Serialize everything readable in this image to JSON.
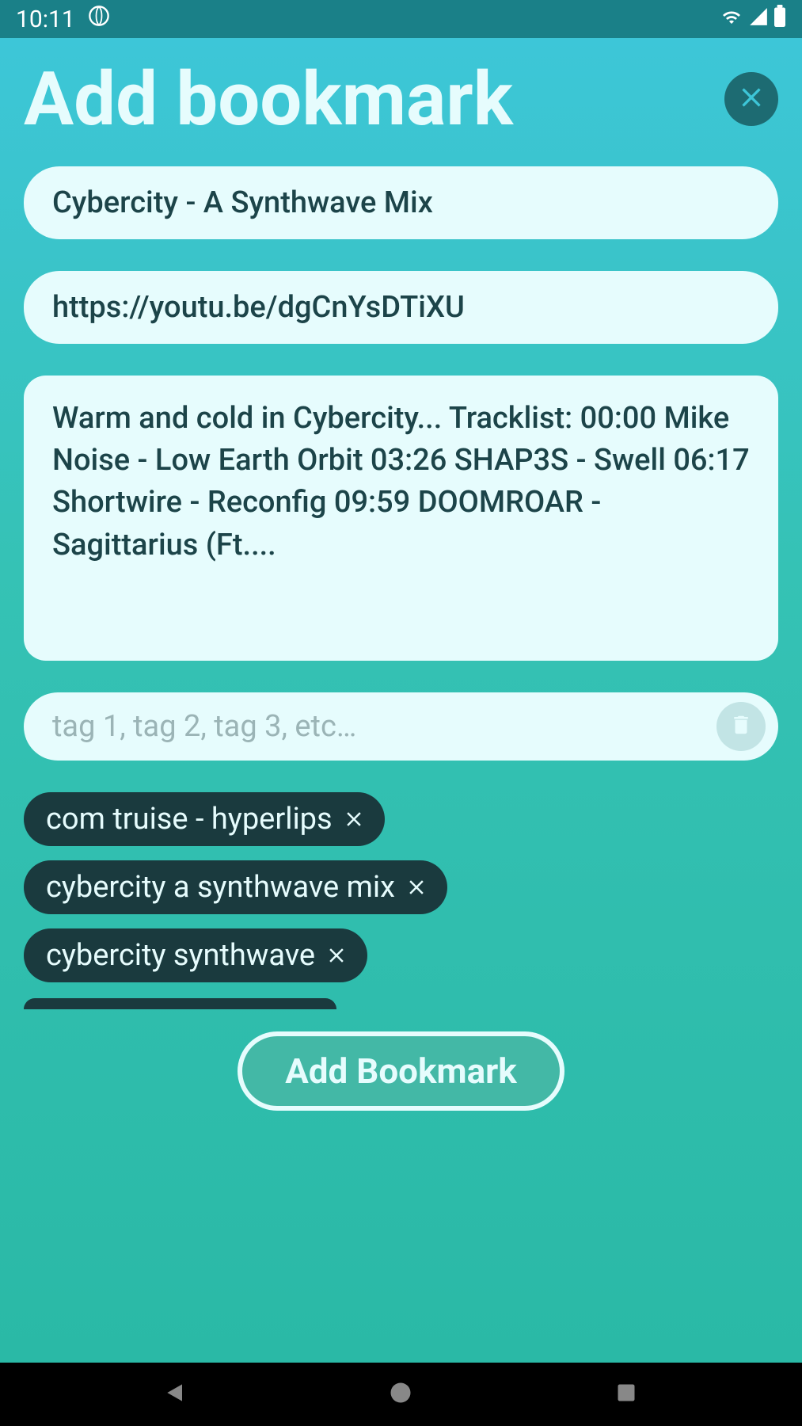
{
  "statusBar": {
    "time": "10:11"
  },
  "header": {
    "title": "Add bookmark"
  },
  "form": {
    "titleValue": "Cybercity - A Synthwave Mix",
    "urlValue": "https://youtu.be/dgCnYsDTiXU",
    "descriptionValue": "Warm and cold in Cybercity... Tracklist: 00:00 Mike Noise - Low Earth Orbit 03:26 SHAP3S - Swell 06:17 Shortwire - Reconfig 09:59 DOOMROAR - Sagittarius (Ft....",
    "tagsPlaceholder": "tag 1, tag 2, tag 3, etc…"
  },
  "tags": [
    "com truise - hyperlips",
    "cybercity a synthwave mix",
    "cybercity synthwave"
  ],
  "submitLabel": "Add Bookmark"
}
